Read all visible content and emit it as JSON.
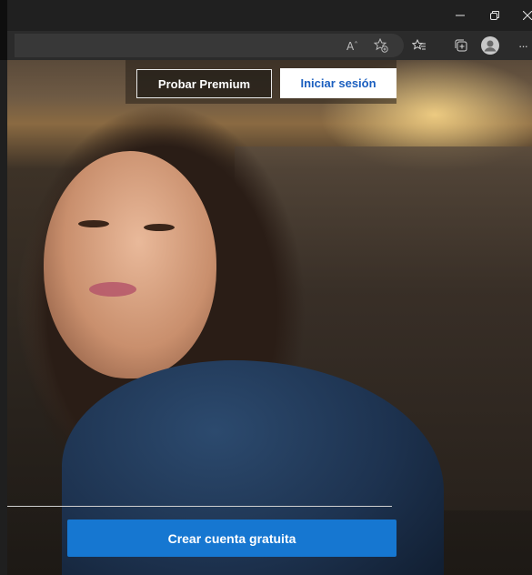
{
  "browser": {
    "window_controls": [
      "minimize-icon",
      "restore-icon",
      "close-icon"
    ],
    "toolbar_icons": [
      "read-aloud-icon",
      "add-favorite-icon",
      "favorites-icon",
      "collections-icon",
      "profile-icon",
      "more-icon"
    ],
    "more_label": "···"
  },
  "page": {
    "premium_button": "Probar Premium",
    "login_button": "Iniciar sesión",
    "create_account_button": "Crear cuenta gratuita"
  },
  "colors": {
    "primary_blue": "#1677d1",
    "login_text": "#1b5fbf"
  }
}
